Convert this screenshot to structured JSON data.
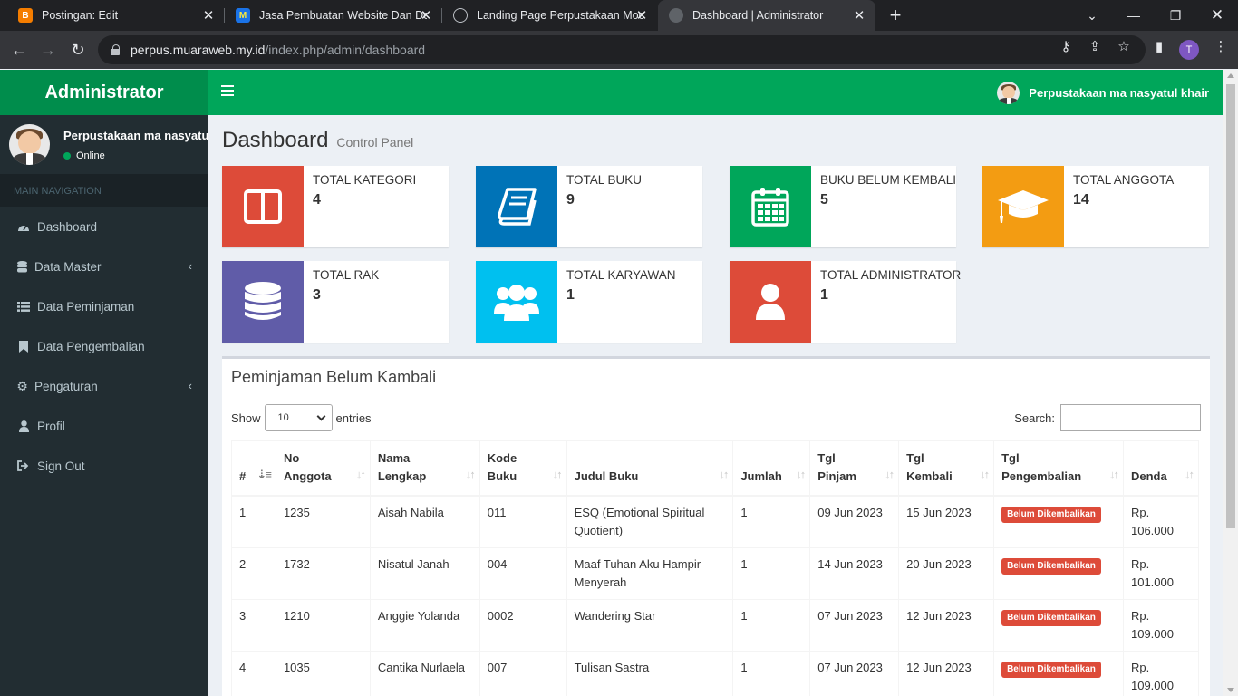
{
  "browser": {
    "tabs": [
      {
        "title": "Postingan: Edit",
        "favicon": "blogger-icon",
        "color": "#f57d00"
      },
      {
        "title": "Jasa Pembuatan Website Dan De",
        "favicon": "site-icon",
        "color": "#1a73e8"
      },
      {
        "title": "Landing Page Perpustakaan Moc",
        "favicon": "openai-icon",
        "color": "#5f6368"
      },
      {
        "title": "Dashboard | Administrator",
        "favicon": "globe-icon",
        "color": "#5f6368"
      }
    ],
    "url_domain": "perpus.muaraweb.my.id",
    "url_path": "/index.php/admin/dashboard",
    "profile_initial": "T"
  },
  "app": {
    "logo": "Administrator",
    "top_user": "Perpustakaan ma nasyatul khair",
    "sidebar_user": "Perpustakaan ma nasyatul khair",
    "status": "Online",
    "nav_header": "MAIN NAVIGATION",
    "nav": [
      {
        "label": "Dashboard",
        "icon": "dashboard-icon"
      },
      {
        "label": "Data Master",
        "icon": "database-icon"
      },
      {
        "label": "Data Peminjaman",
        "icon": "list-icon"
      },
      {
        "label": "Data Pengembalian",
        "icon": "bookmark-icon"
      },
      {
        "label": "Pengaturan",
        "icon": "gear-icon"
      },
      {
        "label": "Profil",
        "icon": "user-icon"
      },
      {
        "label": "Sign Out",
        "icon": "sign-out-icon"
      }
    ],
    "page_title": "Dashboard",
    "page_subtitle": "Control Panel",
    "stats": [
      {
        "label": "TOTAL KATEGORI",
        "value": "4",
        "color": "#dd4b39",
        "icon": "columns-icon"
      },
      {
        "label": "TOTAL BUKU",
        "value": "9",
        "color": "#0073b7",
        "icon": "book-icon"
      },
      {
        "label": "BUKU BELUM KEMBALI",
        "value": "5",
        "color": "#00a65a",
        "icon": "calendar-icon"
      },
      {
        "label": "TOTAL ANGGOTA",
        "value": "14",
        "color": "#f39c12",
        "icon": "graduation-cap-icon"
      },
      {
        "label": "TOTAL RAK",
        "value": "3",
        "color": "#605ca8",
        "icon": "database-icon"
      },
      {
        "label": "TOTAL KARYAWAN",
        "value": "1",
        "color": "#00c0ef",
        "icon": "users-icon"
      },
      {
        "label": "TOTAL ADMINISTRATOR",
        "value": "1",
        "color": "#dd4b39",
        "icon": "user-icon"
      }
    ],
    "table_box": {
      "title": "Peminjaman Belum Kambali",
      "show_label": "Show",
      "entries_value": "10",
      "entries_label": "entries",
      "search_label": "Search:",
      "headers": [
        [
          "#"
        ],
        [
          "No",
          "Anggota"
        ],
        [
          "Nama",
          "Lengkap"
        ],
        [
          "Kode",
          "Buku"
        ],
        [
          "Judul Buku"
        ],
        [
          "Jumlah"
        ],
        [
          "Tgl",
          "Pinjam"
        ],
        [
          "Tgl",
          "Kembali"
        ],
        [
          "Tgl",
          "Pengembalian"
        ],
        [
          "Denda"
        ]
      ],
      "rows": [
        {
          "no": "1",
          "anggota": "1235",
          "nama": "Aisah Nabila",
          "kode": "011",
          "judul": "ESQ (Emotional Spiritual Quotient)",
          "jumlah": "1",
          "pinjam": "09 Jun 2023",
          "kembali": "15 Jun 2023",
          "status": "Belum Dikembalikan",
          "denda": "Rp. 106.000"
        },
        {
          "no": "2",
          "anggota": "1732",
          "nama": "Nisatul Janah",
          "kode": "004",
          "judul": "Maaf Tuhan Aku Hampir Menyerah",
          "jumlah": "1",
          "pinjam": "14 Jun 2023",
          "kembali": "20 Jun 2023",
          "status": "Belum Dikembalikan",
          "denda": "Rp. 101.000"
        },
        {
          "no": "3",
          "anggota": "1210",
          "nama": "Anggie Yolanda",
          "kode": "0002",
          "judul": "Wandering Star",
          "jumlah": "1",
          "pinjam": "07 Jun 2023",
          "kembali": "12 Jun 2023",
          "status": "Belum Dikembalikan",
          "denda": "Rp. 109.000"
        },
        {
          "no": "4",
          "anggota": "1035",
          "nama": "Cantika Nurlaela",
          "kode": "007",
          "judul": "Tulisan Sastra",
          "jumlah": "1",
          "pinjam": "07 Jun 2023",
          "kembali": "12 Jun 2023",
          "status": "Belum Dikembalikan",
          "denda": "Rp. 109.000"
        }
      ]
    }
  }
}
